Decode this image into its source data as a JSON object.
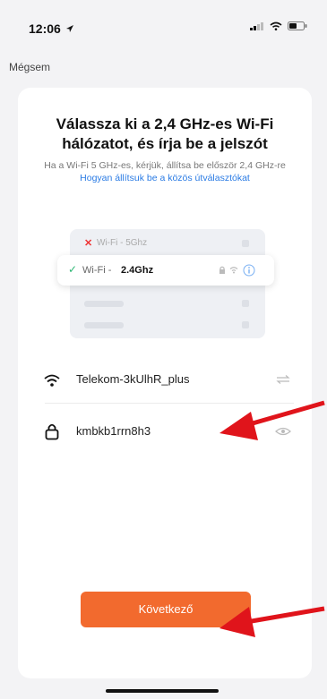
{
  "status": {
    "time": "12:06"
  },
  "cancel_label": "Mégsem",
  "title": "Válassza ki a 2,4 GHz-es Wi-Fi hálózatot, és írja be a jelszót",
  "subtitle": {
    "text": "Ha a Wi-Fi 5 GHz-es, kérjük, állítsa be először 2,4 GHz-re ",
    "link": "Hogyan állítsuk be a közös útválasztókat"
  },
  "illustration": {
    "wifi5_label": "Wi-Fi - 5Ghz",
    "wifi24_prefix": "Wi-Fi - ",
    "wifi24_band": "2.4Ghz"
  },
  "network": {
    "ssid": "Telekom-3kUlhR_plus",
    "password": "kmbkb1rrn8h3"
  },
  "next_label": "Következő",
  "colors": {
    "accent": "#f26a2e",
    "link": "#2a7be4",
    "arrow": "#e0141b"
  }
}
